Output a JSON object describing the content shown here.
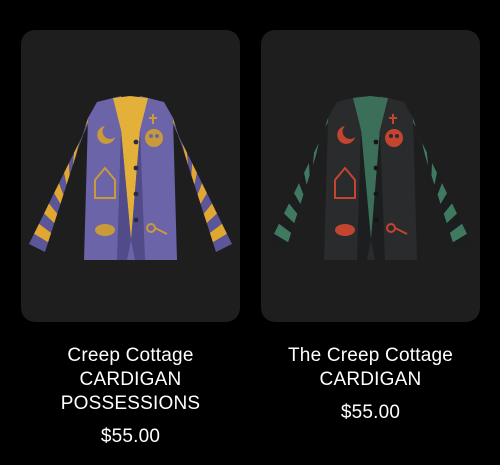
{
  "products": [
    {
      "title": "Creep Cottage\nCARDIGAN\nPOSSESSIONS",
      "price": "$55.00",
      "image_icon": "purple-striped-cardigan-image",
      "colors": {
        "body": "#6b64a8",
        "body_dark": "#514b8a",
        "stripe_a": "#e0a733",
        "stripe_b": "#5b559a",
        "collar": "#e3b13a",
        "motif": "#c99a3a",
        "button": "#2c2a40"
      }
    },
    {
      "title": "The Creep Cottage\nCARDIGAN",
      "price": "$55.00",
      "image_icon": "black-green-cardigan-image",
      "colors": {
        "body": "#2a2b2c",
        "body_dark": "#1d1e1f",
        "stripe_a": "#3f7a60",
        "stripe_b": "#1c1d1e",
        "collar": "#3b6f5a",
        "motif": "#c4452f",
        "button": "#151515"
      }
    }
  ]
}
